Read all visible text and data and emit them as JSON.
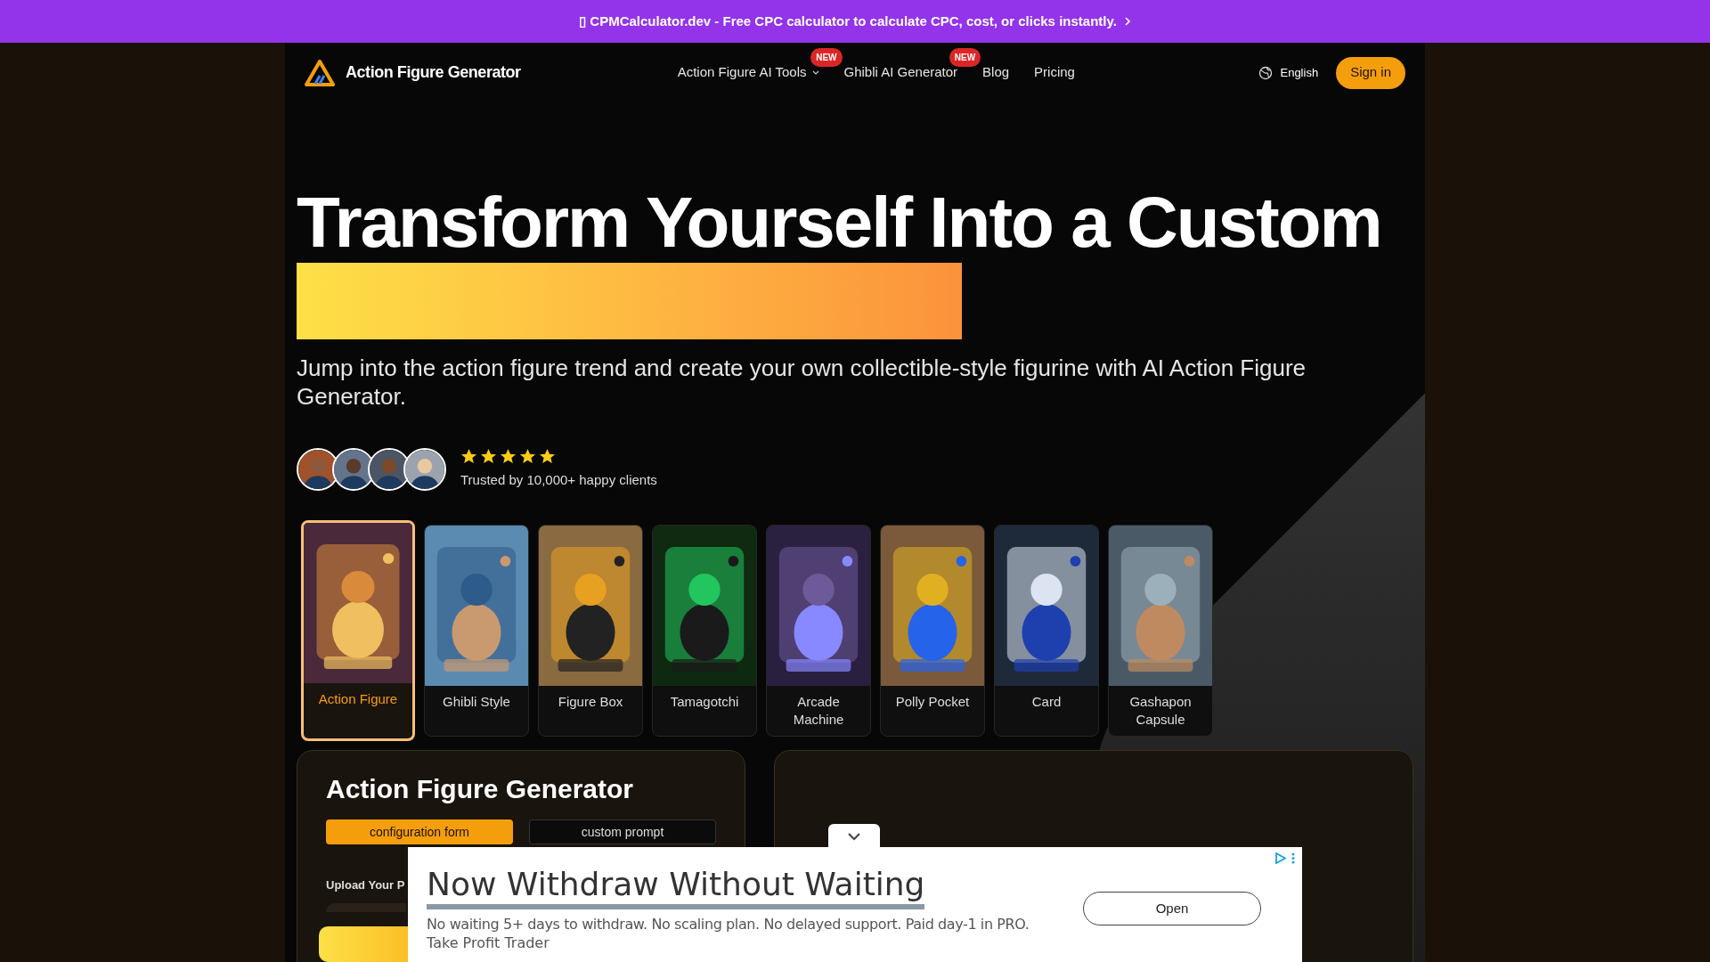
{
  "promo_banner": {
    "icon": "▯",
    "text": "CPMCalculator.dev - Free CPC calculator to calculate CPC, cost, or clicks instantly."
  },
  "nav": {
    "brand": "Action Figure Generator",
    "links": [
      {
        "label": "Action Figure AI Tools",
        "dropdown": true,
        "badge": "NEW"
      },
      {
        "label": "Ghibli AI Generator",
        "dropdown": false,
        "badge": "NEW"
      },
      {
        "label": "Blog",
        "dropdown": false
      },
      {
        "label": "Pricing",
        "dropdown": false
      }
    ],
    "language": "English",
    "sign_in": "Sign in"
  },
  "hero": {
    "title": "Transform Yourself Into a Custom",
    "subtitle": "Jump into the action figure trend and create your own collectible-style figurine with AI Action Figure Generator.",
    "stars": 5,
    "trust_text": "Trusted by 10,000+ happy clients"
  },
  "styles": [
    {
      "label": "Action Figure",
      "selected": true
    },
    {
      "label": "Ghibli Style",
      "selected": false
    },
    {
      "label": "Figure Box",
      "selected": false
    },
    {
      "label": "Tamagotchi",
      "selected": false
    },
    {
      "label": "Arcade Machine",
      "selected": false
    },
    {
      "label": "Polly Pocket",
      "selected": false
    },
    {
      "label": "Card",
      "selected": false
    },
    {
      "label": "Gashapon Capsule",
      "selected": false
    }
  ],
  "generator": {
    "title": "Action Figure Generator",
    "tabs": [
      {
        "label": "configuration form",
        "selected": true
      },
      {
        "label": "custom prompt",
        "selected": false
      }
    ],
    "upload_label": "Upload Your P"
  },
  "ad": {
    "headline": "Now Withdraw Without Waiting",
    "body": "No waiting 5+ days to withdraw. No scaling plan. No delayed support. Paid day-1 in PRO.",
    "advertiser": "Take Profit Trader",
    "button": "Open"
  }
}
